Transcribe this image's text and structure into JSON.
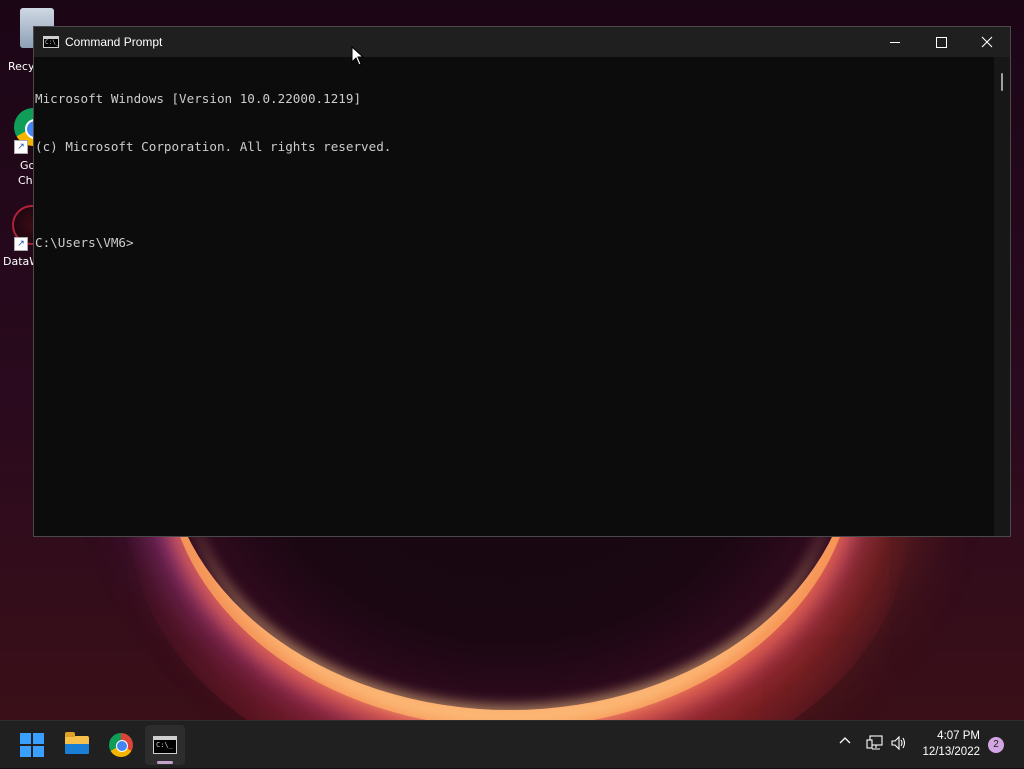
{
  "desktop": {
    "icons": [
      {
        "label": "Recy"
      },
      {
        "label_line1": "Go",
        "label_line2": "Chr"
      },
      {
        "label": "DataW"
      }
    ]
  },
  "window": {
    "title": "Command Prompt",
    "controls": {
      "minimize": "minimize-icon",
      "maximize": "maximize-icon",
      "close": "close-icon"
    },
    "console_lines": [
      "Microsoft Windows [Version 10.0.22000.1219]",
      "(c) Microsoft Corporation. All rights reserved.",
      "",
      "C:\\Users\\VM6>"
    ],
    "colors": {
      "background": "#0c0c0c",
      "text": "#cccccc",
      "titlebar": "#1f1f1f"
    }
  },
  "taskbar": {
    "apps": [
      {
        "name": "start",
        "icon": "windows-start-icon"
      },
      {
        "name": "file-explorer",
        "icon": "folder-icon"
      },
      {
        "name": "chrome",
        "icon": "chrome-icon"
      },
      {
        "name": "command-prompt",
        "icon": "cmd-icon",
        "active": true
      }
    ],
    "cmd_glyph": "C:\\_",
    "tray": {
      "chevron": "^",
      "time": "4:07 PM",
      "date": "12/13/2022",
      "notification_count": "2"
    }
  }
}
